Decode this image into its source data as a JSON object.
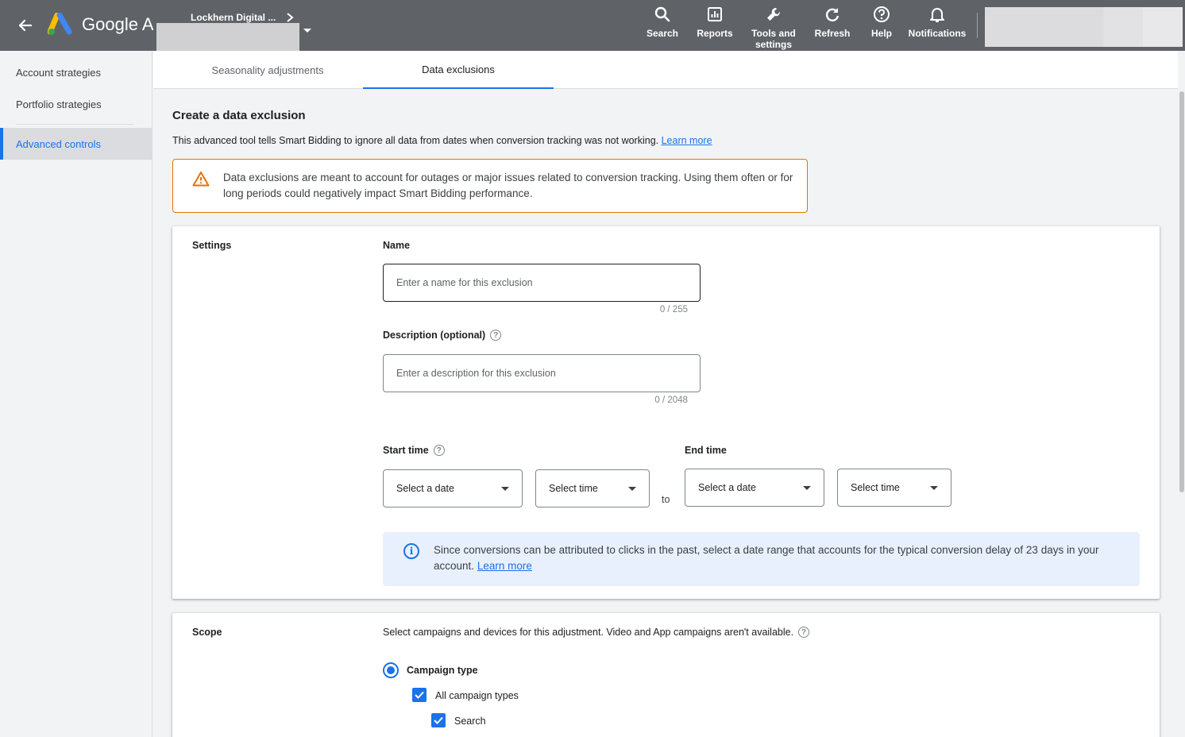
{
  "header": {
    "brand": "Google Ads",
    "account_name": "Lockhern Digital ...",
    "nav": [
      {
        "icon": "search-icon",
        "label": "Search"
      },
      {
        "icon": "reports-icon",
        "label": "Reports"
      },
      {
        "icon": "wrench-icon",
        "label": "Tools and settings"
      },
      {
        "icon": "refresh-icon",
        "label": "Refresh"
      },
      {
        "icon": "help-icon",
        "label": "Help"
      },
      {
        "icon": "bell-icon",
        "label": "Notifications"
      }
    ]
  },
  "sidebar": {
    "items": [
      {
        "label": "Account strategies"
      },
      {
        "label": "Portfolio strategies"
      },
      {
        "label": "Advanced controls"
      }
    ],
    "active_index": 2
  },
  "tabs": [
    {
      "label": "Seasonality adjustments"
    },
    {
      "label": "Data exclusions"
    }
  ],
  "page": {
    "title": "Create a data exclusion",
    "description": "This advanced tool tells Smart Bidding to ignore all data from dates when conversion tracking was not working.",
    "learn_more": "Learn more"
  },
  "warning": {
    "text": "Data exclusions are meant to account for outages or major issues related to conversion tracking. Using them often or for long periods could negatively impact Smart Bidding performance."
  },
  "settings": {
    "label": "Settings",
    "name_label": "Name",
    "name_placeholder": "Enter a name for this exclusion",
    "name_counter": "0 / 255",
    "desc_label": "Description (optional)",
    "desc_placeholder": "Enter a description for this exclusion",
    "desc_counter": "0 / 2048",
    "start_label": "Start time",
    "end_label": "End time",
    "select_date": "Select a date",
    "select_time": "Select time",
    "to": "to",
    "info_text": "Since conversions can be attributed to clicks in the past, select a date range that accounts for the typical conversion delay of 23 days in your account.",
    "info_learn_more": "Learn more"
  },
  "scope": {
    "label": "Scope",
    "description": "Select campaigns and devices for this adjustment. Video and App campaigns aren't available.",
    "campaign_type": "Campaign type",
    "all_campaign_types": "All campaign types",
    "search": "Search"
  },
  "colors": {
    "header_bg": "#5f6368",
    "accent": "#1a73e8",
    "warning_border": "#e37400",
    "info_bg": "#e8f0fe"
  }
}
